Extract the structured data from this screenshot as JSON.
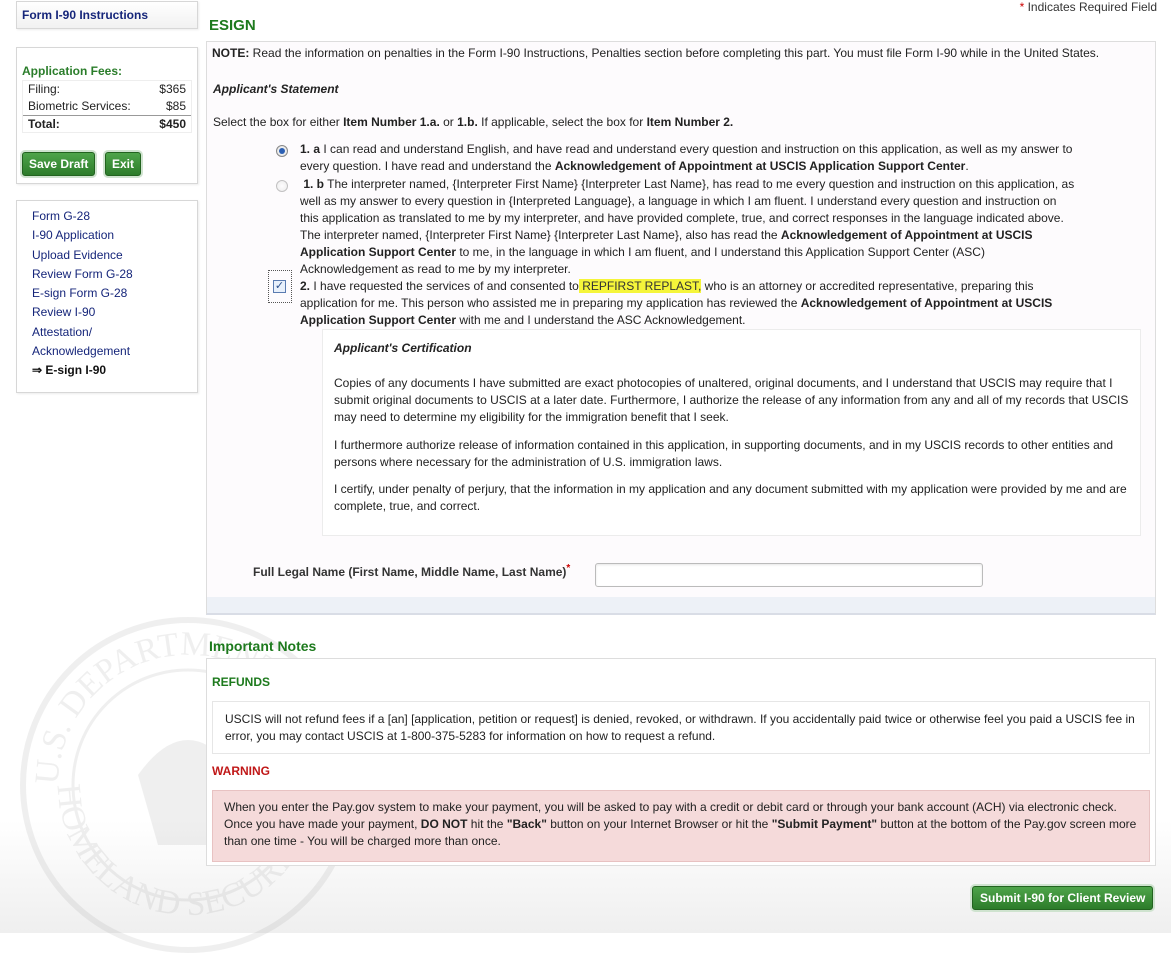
{
  "header": {
    "required_star": "*",
    "required_note": "Indicates Required Field"
  },
  "sidebar": {
    "form_title": "Form I-90 Instructions",
    "fees": {
      "heading": "Application Fees:",
      "rows": [
        {
          "label": "Filing:",
          "value": "$365"
        },
        {
          "label": "Biometric Services:",
          "value": "$85"
        },
        {
          "label": "Total:",
          "value": "$450"
        }
      ]
    },
    "save_draft": "Save Draft",
    "exit": "Exit",
    "nav": [
      {
        "label": "Form G-28"
      },
      {
        "label": "I-90 Application"
      },
      {
        "label": "Upload Evidence"
      },
      {
        "label": "Review Form G-28"
      },
      {
        "label": "E-sign Form G-28"
      },
      {
        "label": "Review I-90"
      },
      {
        "label": "Attestation/"
      },
      {
        "label": "Acknowledgement"
      },
      {
        "label": "⇒ E-sign I-90"
      }
    ]
  },
  "esign": {
    "title": "ESIGN",
    "note_label": "NOTE:",
    "note_text": " Read the information on penalties in the Form I-90 Instructions, Penalties section before completing this part. You must file Form I-90 while in the United States.",
    "statement_heading": "Applicant's Statement",
    "select_pre": "Select the box for either ",
    "select_item1": "Item Number 1.a.",
    "select_or": " or ",
    "select_item1b": "1.b.",
    "select_mid": " If applicable, select the box for ",
    "select_item2": "Item Number 2.",
    "opt_1a_num": "1. a",
    "opt_1a_text": " I can read and understand English, and have read and understand every question and instruction on this application, as well as my answer to every question. I have read and understand the ",
    "opt_1a_bold": "Acknowledgement of Appointment at USCIS Application Support Center",
    "opt_1a_end": ".",
    "opt_1b_num": "1. b",
    "opt_1b_text": " The interpreter named, {Interpreter First Name} {Interpreter Last Name}, has read to me every question and instruction on this application, as well as my answer to every question in {Interpreted Language}, a language in which I am fluent. I understand every question and instruction on this application as translated to me by my interpreter, and have provided complete, true, and correct responses in the language indicated above. The interpreter named, {Interpreter First Name} {Interpreter Last Name}, also has read the ",
    "opt_1b_bold": "Acknowledgement of Appointment at USCIS Application Support Center",
    "opt_1b_end": " to me, in the language in which I am fluent, and I understand this Application Support Center (ASC) Acknowledgement as read to me by my interpreter.",
    "opt_2_num": "2.",
    "opt_2_pre": " I have requested the services of and consented to",
    "opt_2_name": " REPFIRST REPLAST,",
    "opt_2_mid": " who is an attorney or accredited representative, preparing this application for me. This person who assisted me in preparing my application has reviewed the ",
    "opt_2_bold": "Acknowledgement of Appointment at USCIS Application Support Center",
    "opt_2_end": " with me and I understand the ASC Acknowledgement.",
    "opt_2_checkmark": "✓",
    "certification": {
      "heading": "Applicant's Certification",
      "p1": "Copies of any documents I have submitted are exact photocopies of unaltered, original documents, and I understand that USCIS may require that I submit original documents to USCIS at a later date. Furthermore, I authorize the release of any information from any and all of my records that USCIS may need to determine my eligibility for the immigration benefit that I seek.",
      "p2": "I furthermore authorize release of information contained in this application, in supporting documents, and in my USCIS records to other entities and persons where necessary for the administration of U.S. immigration laws.",
      "p3": "I certify, under penalty of perjury, that the information in my application and any document submitted with my application were provided by me and are complete, true, and correct."
    },
    "full_name_label": "Full Legal Name (First Name, Middle Name, Last Name)",
    "full_name_star": "*",
    "full_name_value": ""
  },
  "notes": {
    "title": "Important Notes",
    "refunds_heading": "REFUNDS",
    "refunds_text": "USCIS will not refund fees if a [an] [application, petition or request] is denied, revoked, or withdrawn. If you accidentally paid twice or otherwise feel you paid a USCIS fee in error, you may contact USCIS at 1-800-375-5283 for information on how to request a refund.",
    "warning_heading": "WARNING",
    "warn_1": "When you enter the Pay.gov system to make your payment, you will be asked to pay with a credit or debit card or through your bank account (ACH) via electronic check. Once you have made your payment, ",
    "warn_do_not": "DO NOT",
    "warn_2": " hit the ",
    "warn_back": "\"Back\"",
    "warn_3": " button on your Internet Browser or hit the ",
    "warn_submit": "\"Submit Payment\"",
    "warn_4": " button at the bottom of the Pay.gov screen more than one time - You will be charged more than once."
  },
  "footer": {
    "submit_label": "Submit I-90 for Client Review"
  },
  "seal": {
    "text_top": "U.S. DEPARTMENT OF",
    "text_bottom": "HOMELAND SECURITY"
  },
  "colors": {
    "heading_green": "#1d7a1d",
    "nav_blue": "#15257a",
    "warning_red": "#c01818",
    "warning_bg": "#f5dada",
    "highlight": "#f5f53a"
  }
}
